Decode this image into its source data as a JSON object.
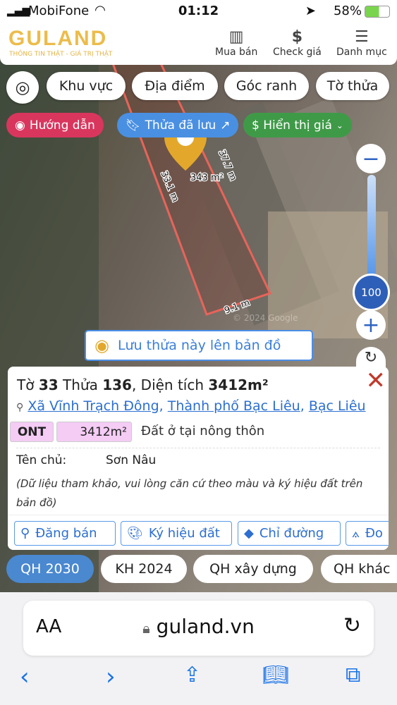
{
  "status_bar": {
    "carrier": "MobiFone",
    "time": "01:12",
    "battery": "58%"
  },
  "header": {
    "logo": "GULAND",
    "slogan": "THÔNG TIN THẬT - GIÁ TRỊ THẬT",
    "nav": [
      {
        "icon": "building-icon",
        "label": "Mua bán"
      },
      {
        "icon": "dollar-icon",
        "label": "Check giá"
      },
      {
        "icon": "menu-icon",
        "label": "Danh mục"
      }
    ]
  },
  "filters": [
    "Khu vực",
    "Địa điểm",
    "Góc ranh",
    "Tờ thửa"
  ],
  "controls": {
    "guide": "Hướng dẫn",
    "saved": "Thửa đã lưu",
    "price": "$ Hiển thị giá",
    "guide_color": "#d9365e",
    "saved_color": "#4a90e2",
    "price_color": "#3f9a48"
  },
  "map": {
    "area_label": "343 m²",
    "edge_left": "33.1 m",
    "edge_right": "37.7 m",
    "edge_bottom": "9.1 m",
    "watermark": "© 2024 Google",
    "zoom_level": "100",
    "save_button": "Lưu thửa này lên bản đồ",
    "parcel_color": "#e8645a"
  },
  "card": {
    "title_parts": [
      "Tờ ",
      "33",
      " Thửa ",
      "136",
      ", Diện tích ",
      "3412m²"
    ],
    "address": [
      "Xã Vĩnh Trạch Đông",
      "Thành phố Bạc Liêu",
      "Bạc Liêu"
    ],
    "land_code": "ONT",
    "land_area": "3412m²",
    "land_type": "Đất ở tại nông thôn",
    "owner_label": "Tên chủ:",
    "owner_value": "Sơn Nâu",
    "note": "(Dữ liệu tham khảo, vui lòng căn cứ theo màu và ký hiệu đất trên bản đồ)",
    "actions": [
      "Đăng bán",
      "Ký hiệu đất",
      "Chỉ đường",
      "Đo"
    ]
  },
  "layer_tabs": [
    {
      "label": "QH 2030",
      "active": true
    },
    {
      "label": "KH 2024"
    },
    {
      "label": "QH xây dựng"
    },
    {
      "label": "QH khác"
    }
  ],
  "browser": {
    "text_size": "AA",
    "domain": "guland.vn"
  }
}
